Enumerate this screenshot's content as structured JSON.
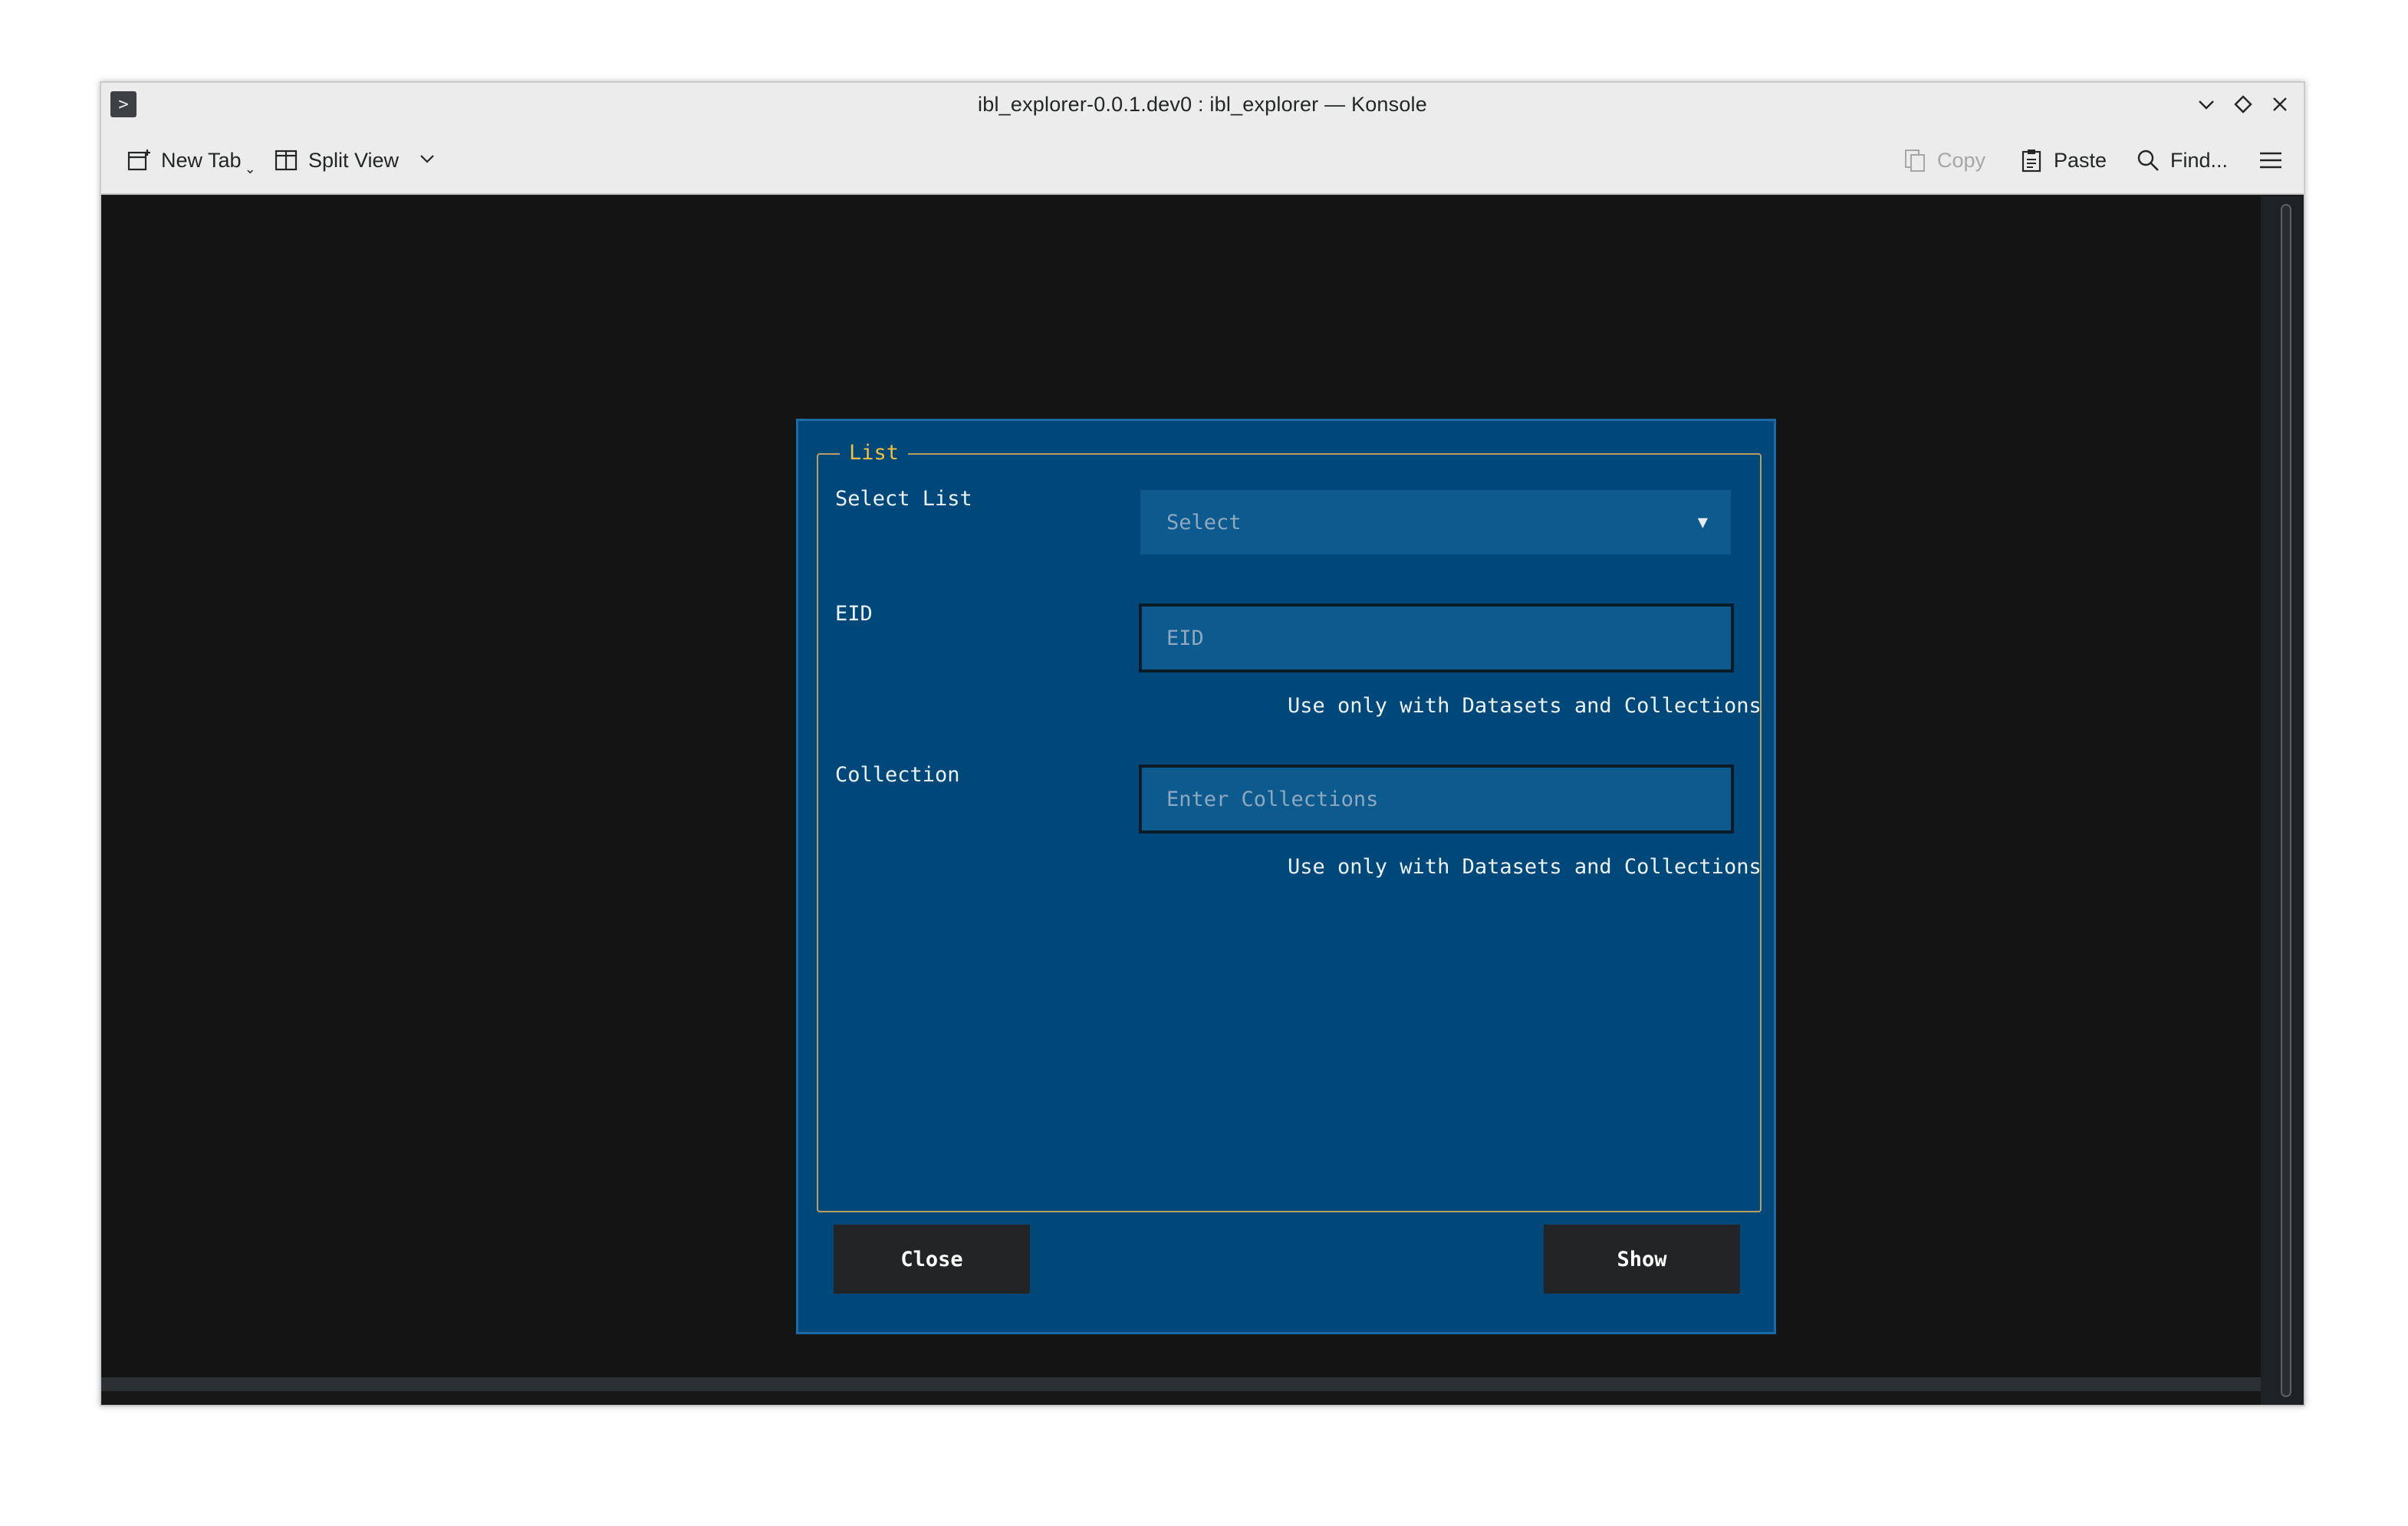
{
  "window": {
    "title": "ibl_explorer-0.0.1.dev0 : ibl_explorer — Konsole",
    "app_icon": "terminal-prompt-icon",
    "controls": [
      "minimize-icon",
      "maximize-icon",
      "close-icon"
    ]
  },
  "toolbar": {
    "new_tab": "New Tab",
    "split_view": "Split View",
    "copy": "Copy",
    "paste": "Paste",
    "find": "Find..."
  },
  "dialog": {
    "legend": "List",
    "select_list_label": "Select List",
    "select_value": "Select",
    "eid_label": "EID",
    "eid_placeholder": "EID",
    "eid_hint": "Use only with Datasets and Collections",
    "collection_label": "Collection",
    "collection_placeholder": "Enter Collections",
    "collection_hint": "Use only with Datasets and Collections",
    "close_button": "Close",
    "show_button": "Show"
  },
  "colors": {
    "dialog_bg": "#00477a",
    "legend": "#f0c040",
    "terminal_bg": "#141414"
  }
}
